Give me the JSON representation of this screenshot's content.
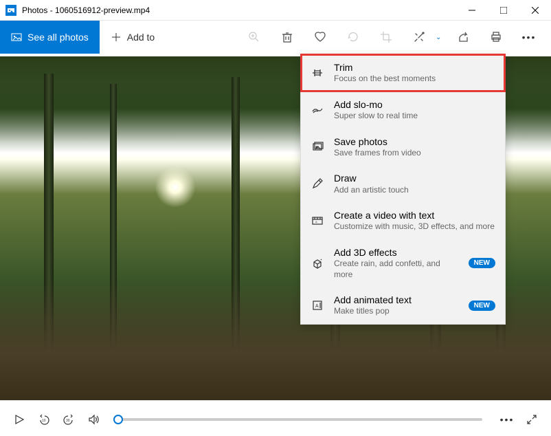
{
  "titlebar": {
    "text": "Photos - 1060516912-preview.mp4"
  },
  "toolbar": {
    "see_all": "See all photos",
    "add_to": "Add to"
  },
  "menu": {
    "items": [
      {
        "title": "Trim",
        "sub": "Focus on the best moments"
      },
      {
        "title": "Add slo-mo",
        "sub": "Super slow to real time"
      },
      {
        "title": "Save photos",
        "sub": "Save frames from video"
      },
      {
        "title": "Draw",
        "sub": "Add an artistic touch"
      },
      {
        "title": "Create a video with text",
        "sub": "Customize with music, 3D effects, and more"
      },
      {
        "title": "Add 3D effects",
        "sub": "Create rain, add confetti, and more"
      },
      {
        "title": "Add animated text",
        "sub": "Make titles pop"
      }
    ],
    "new_badge": "NEW"
  }
}
